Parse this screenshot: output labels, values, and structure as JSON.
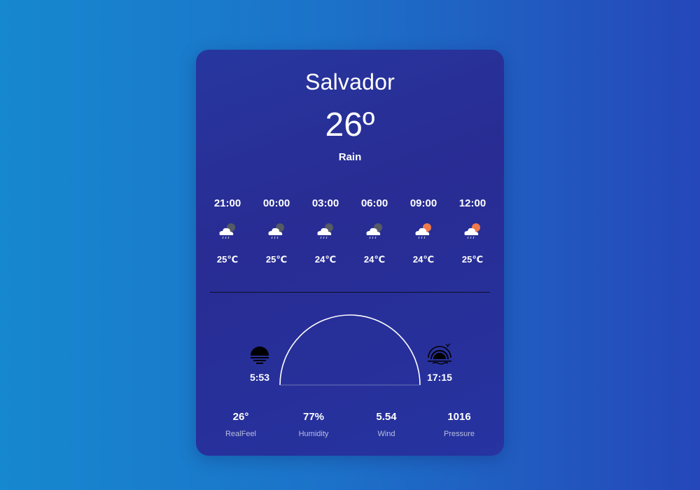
{
  "weather": {
    "city": "Salvador",
    "temperature": "26º",
    "condition": "Rain"
  },
  "forecast": [
    {
      "time": "21:00",
      "temp": "25℃",
      "icon": "night-rain-cloud-icon"
    },
    {
      "time": "00:00",
      "temp": "25℃",
      "icon": "night-rain-cloud-icon"
    },
    {
      "time": "03:00",
      "temp": "24℃",
      "icon": "night-rain-cloud-icon"
    },
    {
      "time": "06:00",
      "temp": "24℃",
      "icon": "night-rain-cloud-icon"
    },
    {
      "time": "09:00",
      "temp": "24℃",
      "icon": "day-rain-cloud-icon"
    },
    {
      "time": "12:00",
      "temp": "25℃",
      "icon": "day-rain-cloud-icon"
    }
  ],
  "sun": {
    "sunrise": "5:53",
    "sunset": "17:15",
    "sunrise_icon": "sunrise-icon",
    "sunset_icon": "sunset-icon"
  },
  "stats": [
    {
      "value": "26°",
      "label": "RealFeel"
    },
    {
      "value": "77%",
      "label": "Humidity"
    },
    {
      "value": "5.54",
      "label": "Wind"
    },
    {
      "value": "1016",
      "label": "Pressure"
    }
  ],
  "colors": {
    "background_start": "#1688cf",
    "background_end": "#2547b9",
    "card": "#282c93",
    "sun_day": "#f07a4a",
    "moon_night": "#555a64"
  }
}
